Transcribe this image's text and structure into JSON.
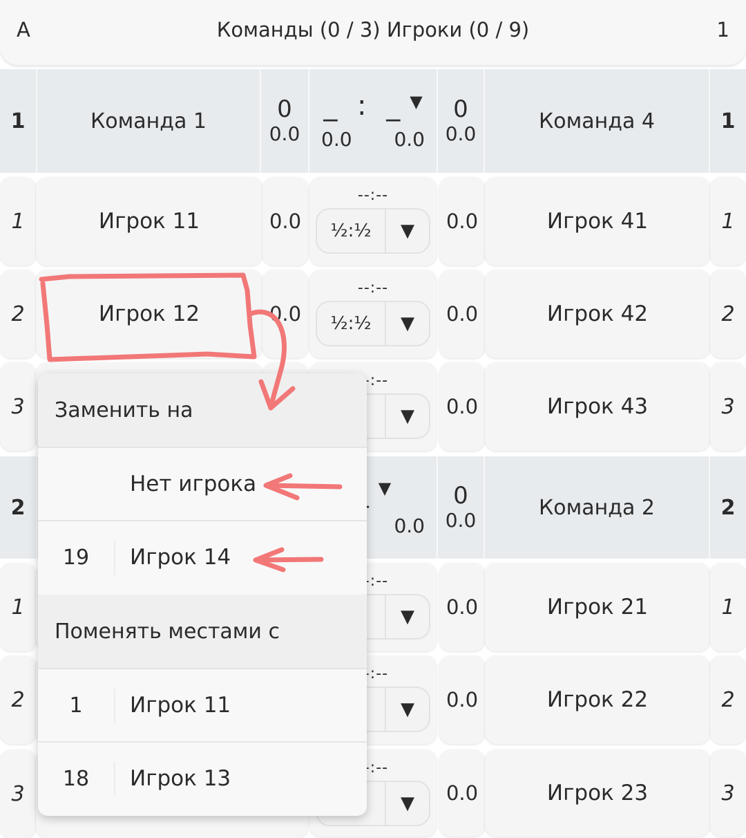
{
  "header": {
    "left": "A",
    "title": "Команды (0 / 3) Игроки (0 / 9)",
    "right": "1"
  },
  "match1": {
    "home_num": "1",
    "home_team": "Команда 1",
    "home_score": "0",
    "home_points": "0.0",
    "mid_score": "_ : _",
    "mid_arrow": "▼",
    "mid_left": "0.0",
    "mid_right": "0.0",
    "away_score": "0",
    "away_points": "0.0",
    "away_team": "Команда 4",
    "away_num": "1",
    "boards": [
      {
        "board": "1",
        "home": "Игрок 11",
        "home_pts": "0.0",
        "result": "--:--",
        "select": "½:½",
        "away_pts": "0.0",
        "away": "Игрок 41",
        "away_board": "1"
      },
      {
        "board": "2",
        "home": "Игрок 12",
        "home_pts": "0.0",
        "result": "--:--",
        "select": "½:½",
        "away_pts": "0.0",
        "away": "Игрок 42",
        "away_board": "2"
      },
      {
        "board": "3",
        "home": "",
        "home_pts": "",
        "result": "--:--",
        "select": "½",
        "away_pts": "0.0",
        "away": "Игрок 43",
        "away_board": "3"
      }
    ]
  },
  "match2": {
    "home_num": "2",
    "mid_score": "_",
    "mid_arrow": "▼",
    "mid_right": "0.0",
    "away_score": "0",
    "away_points": "0.0",
    "away_team": "Команда 2",
    "away_num": "2",
    "boards": [
      {
        "board": "1",
        "result": "--:--",
        "select": "½",
        "away_pts": "0.0",
        "away": "Игрок 21",
        "away_board": "1"
      },
      {
        "board": "2",
        "result": "--:--",
        "select": "½",
        "away_pts": "0.0",
        "away": "Игрок 22",
        "away_board": "2"
      },
      {
        "board": "3",
        "result": "--:--",
        "select": "½",
        "away_pts": "0.0",
        "away": "Игрок 23",
        "away_board": "3"
      }
    ]
  },
  "menu": {
    "replace_header": "Заменить на",
    "replace_items": [
      {
        "num": "",
        "name": "Нет игрока"
      },
      {
        "num": "19",
        "name": "Игрок 14"
      }
    ],
    "swap_header": "Поменять местами с",
    "swap_items": [
      {
        "num": "1",
        "name": "Игрок 11"
      },
      {
        "num": "18",
        "name": "Игрок 13"
      }
    ]
  },
  "colors": {
    "annotation": "#f27777",
    "match_header_bg": "#e8ebee",
    "cell_bg": "#f5f5f5"
  },
  "icons": {
    "dropdown": "triangle-down"
  }
}
